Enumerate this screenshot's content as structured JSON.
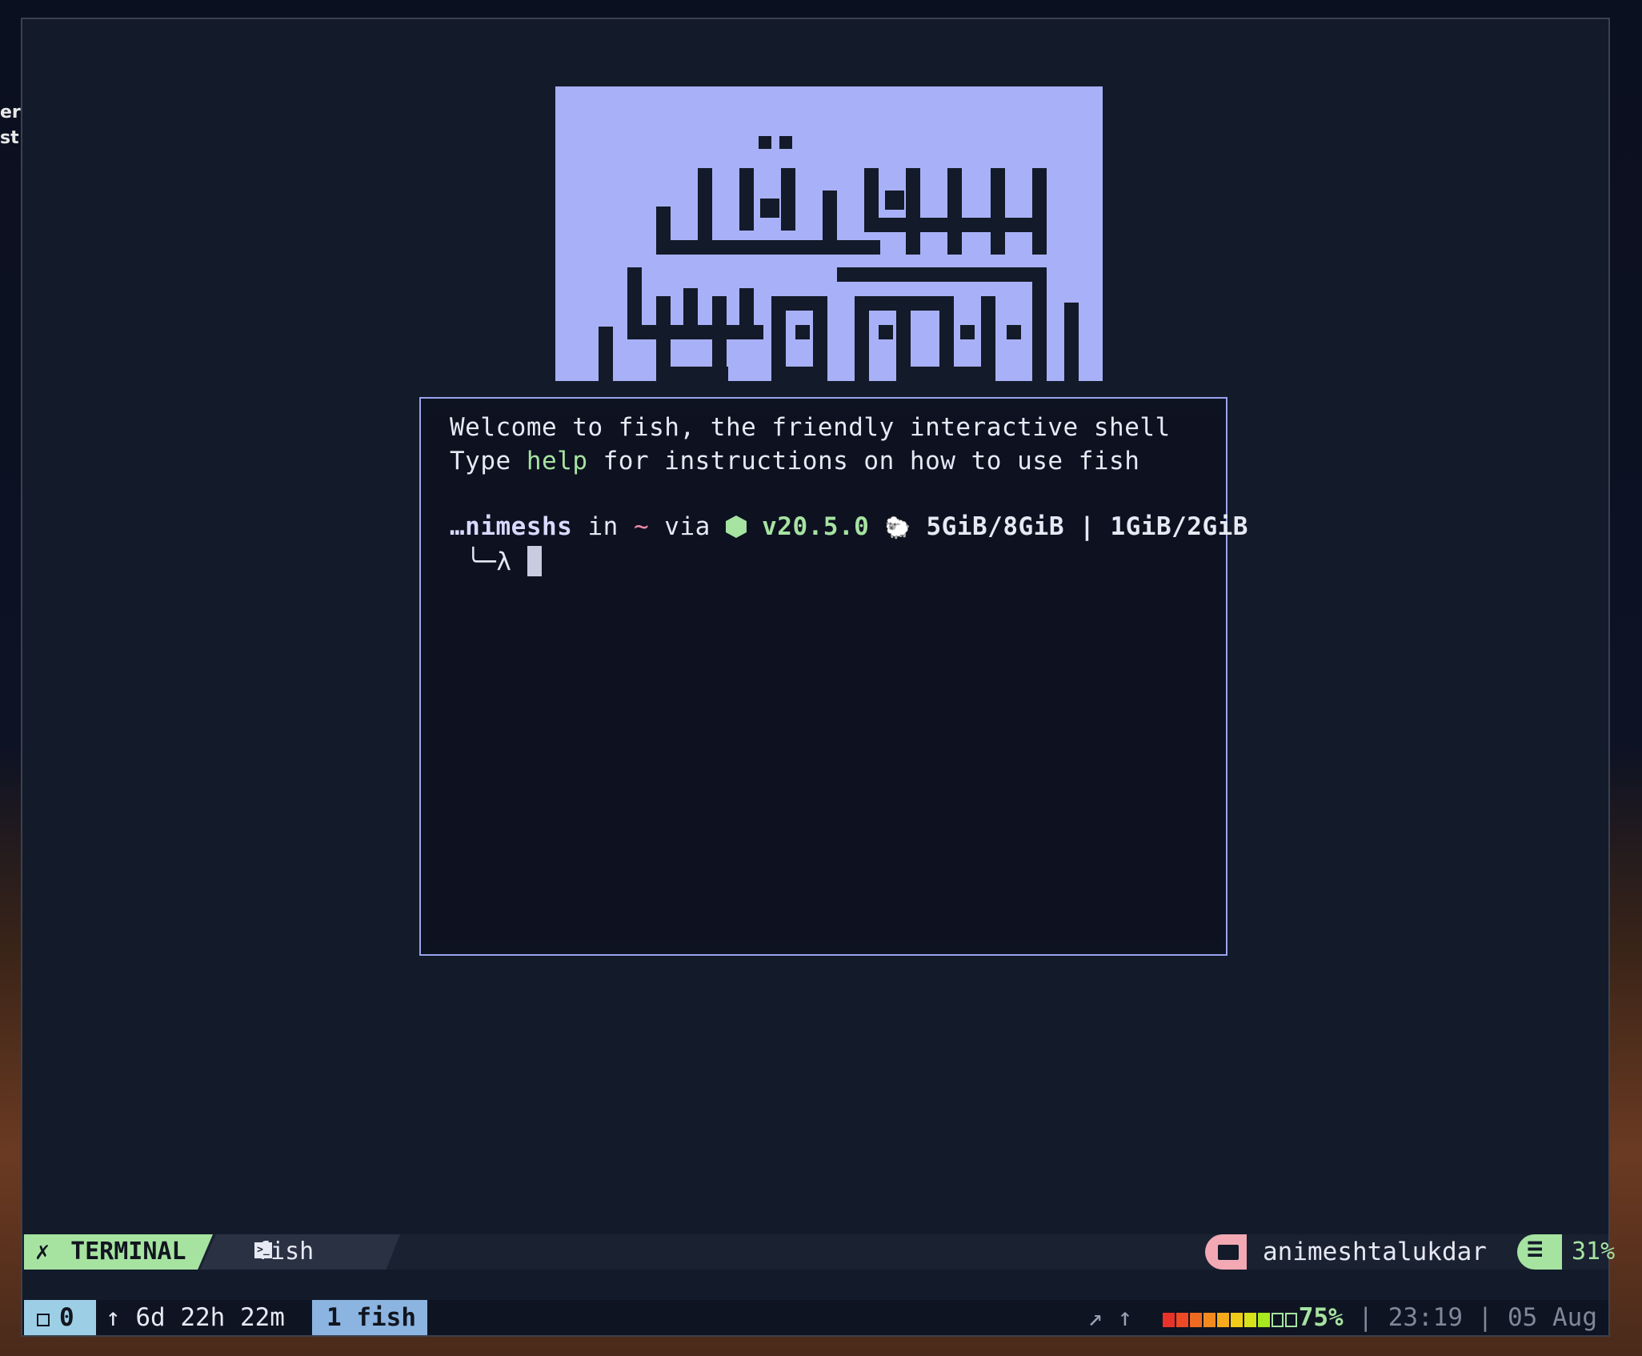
{
  "desktop": {
    "clipped_text_1": "ers",
    "clipped_text_2": "st"
  },
  "terminal": {
    "welcome_line1": "Welcome to fish, the friendly interactive shell",
    "welcome_type": "Type ",
    "welcome_help": "help",
    "welcome_rest": " for instructions on how to use fish",
    "prompt_user": "…nimeshs",
    "prompt_in": " in ",
    "prompt_tilde": "~",
    "prompt_via": " via ",
    "node_version": "v20.5.0",
    "memory": "5GiB/8GiB | 1GiB/2GiB",
    "prompt_branch": "╰─λ"
  },
  "status_top": {
    "mode": "TERMINAL",
    "tab": "fish",
    "user": "animeshtalukdar",
    "percent": "31%"
  },
  "status_bottom": {
    "session": "0",
    "uptime": "↑ 6d 22h 22m",
    "window": "1 fish",
    "arrows": "↗ ↑",
    "battery_level": 0.75,
    "battery_text": "75%",
    "sep": " | ",
    "time": "23:19",
    "date": "05 Aug"
  },
  "colors": {
    "accent_green": "#a6e3a1",
    "accent_lavender": "#a8b1f7",
    "accent_pink": "#f2a9b3",
    "battery_cells": [
      "#e8322a",
      "#ee4a25",
      "#f06a22",
      "#f48a1e",
      "#f6aa1c",
      "#f0cc18",
      "#d8e21a",
      "#a8e81e",
      "#0f1422",
      "#0f1422"
    ]
  }
}
